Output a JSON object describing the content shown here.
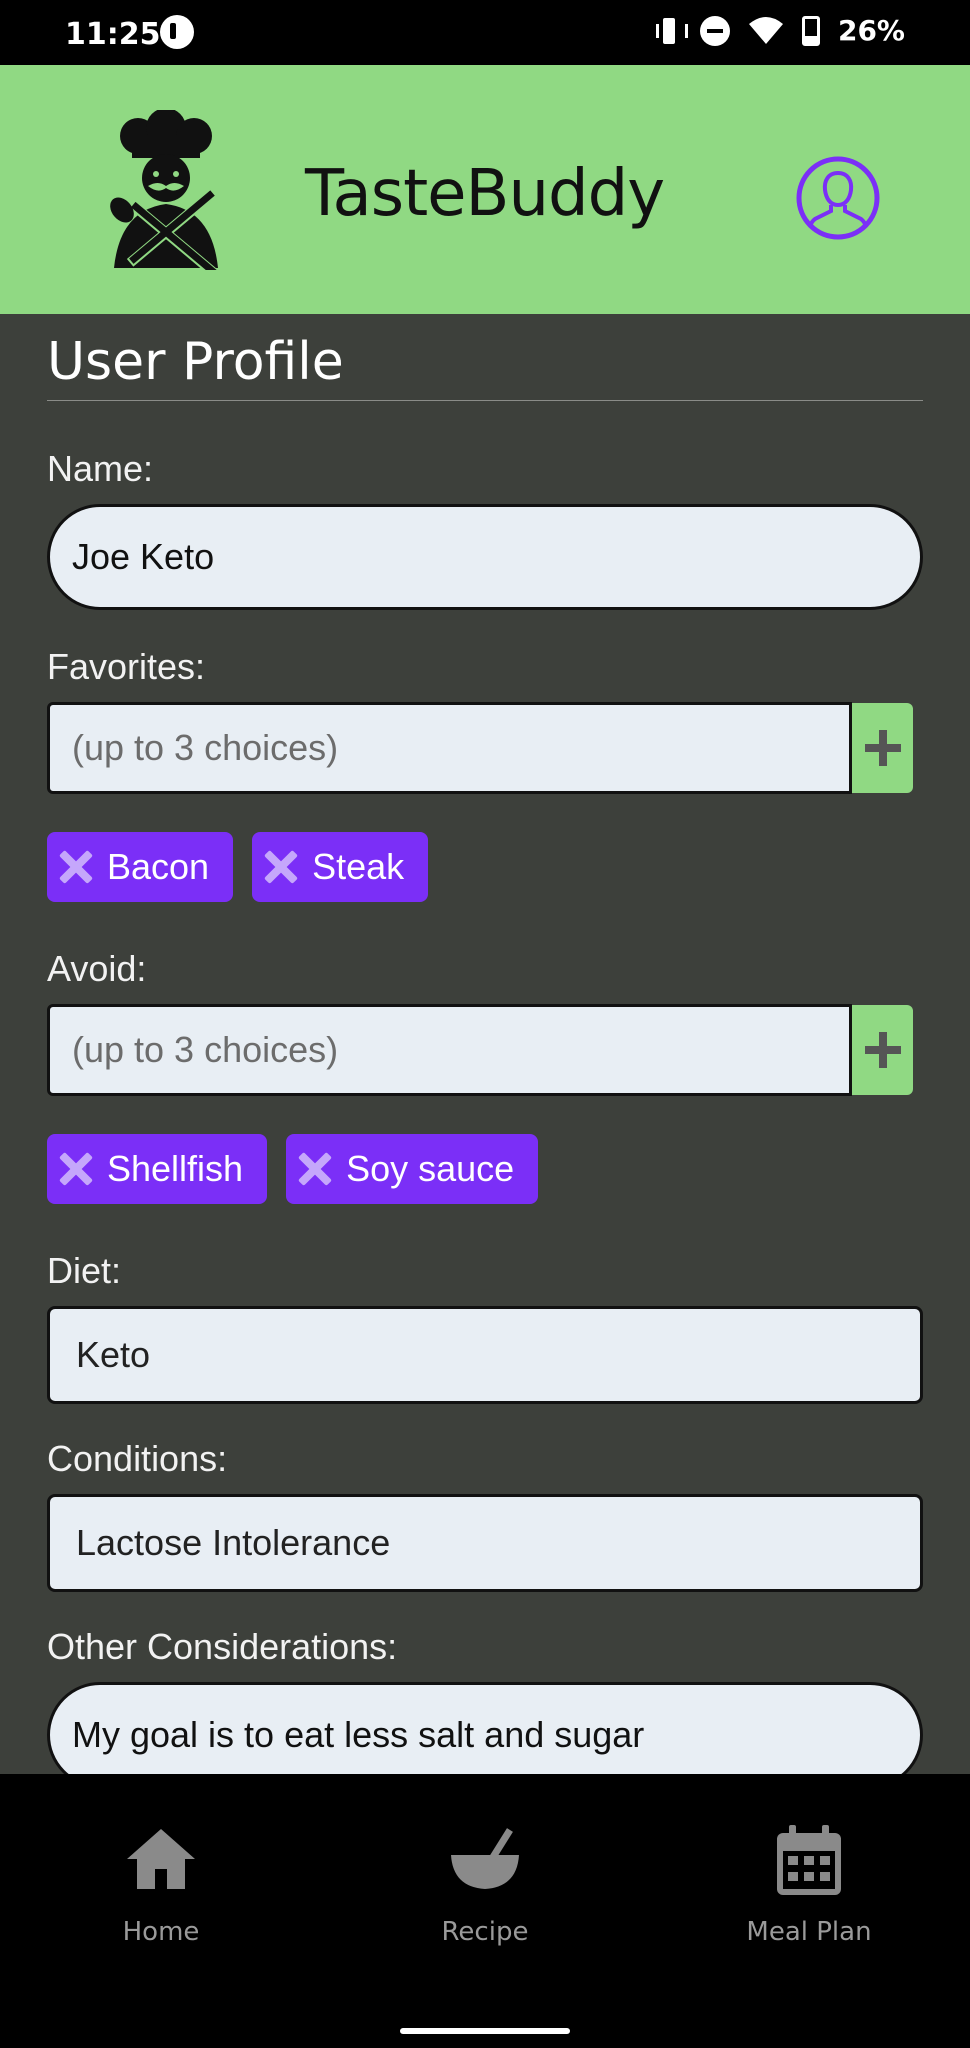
{
  "status_bar": {
    "time": "11:25",
    "battery": "26%"
  },
  "header": {
    "app_title": "TasteBuddy",
    "colors": {
      "header_bg": "#90d983",
      "accent": "#7b2ff7"
    }
  },
  "profile": {
    "title": "User Profile",
    "name_label": "Name:",
    "name_value": "Joe Keto",
    "favorites_label": "Favorites:",
    "favorites_placeholder": "(up to 3 choices)",
    "favorites": [
      "Bacon",
      "Steak"
    ],
    "avoid_label": "Avoid:",
    "avoid_placeholder": "(up to 3 choices)",
    "avoid": [
      "Shellfish",
      "Soy sauce"
    ],
    "diet_label": "Diet:",
    "diet_value": "Keto",
    "conditions_label": "Conditions:",
    "conditions_value": "Lactose Intolerance",
    "other_label": "Other Considerations:",
    "other_value": "My goal is to eat less salt and sugar"
  },
  "nav": {
    "items": [
      {
        "label": "Home",
        "icon": "home-icon"
      },
      {
        "label": "Recipe",
        "icon": "bowl-icon"
      },
      {
        "label": "Meal Plan",
        "icon": "calendar-icon"
      }
    ]
  }
}
